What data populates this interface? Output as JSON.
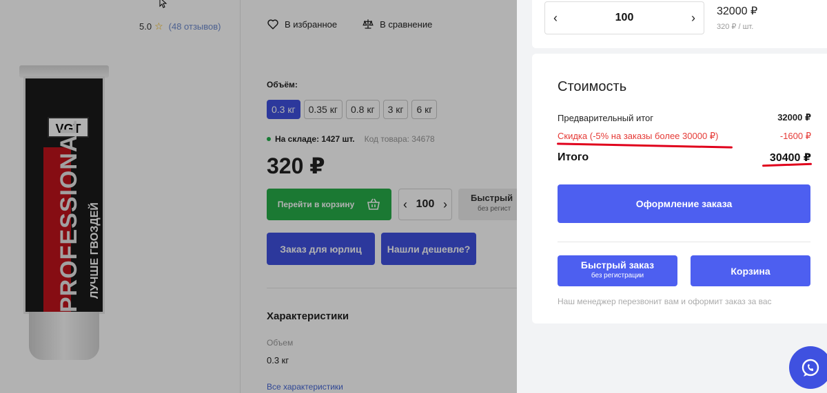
{
  "product": {
    "rating": "5.0",
    "reviews": "(48 отзывов)",
    "favorite_label": "В избранное",
    "compare_label": "В сравнение",
    "image": {
      "brand": "VGT",
      "line": "PROFESSIONAL",
      "slogan": "ЛУЧШЕ ГВОЗДЕЙ"
    },
    "volume_label": "Объём:",
    "volume_options": [
      "0.3 кг",
      "0.35 кг",
      "0.8 кг",
      "3 кг",
      "6 кг"
    ],
    "volume_selected": "0.3 кг",
    "stock_text": "На складе: 1427 шт.",
    "code_text": "Код товара: 34678",
    "price": "320 ₽",
    "go_to_cart_label": "Перейти в корзину",
    "quantity": "100",
    "quick_order_line1": "Быстрый",
    "quick_order_line2": "без регист",
    "legal_order_label": "Заказ для юрлиц",
    "found_cheaper_label": "Нашли дешевле?",
    "characteristics_title": "Характеристики",
    "char_key": "Объем",
    "char_value": "0.3 кг",
    "all_chars_link": "Все характеристики"
  },
  "cart": {
    "quantity": "100",
    "line_total": "32000 ₽",
    "unit_price": "320 ₽ / шт.",
    "cost_title": "Стоимость",
    "subtotal_label": "Предварительный итог",
    "subtotal_value": "32000 ₽",
    "discount_label": "Скидка (-5% на заказы более 30000 ₽)",
    "discount_value": "-1600 ₽",
    "total_label": "Итого",
    "total_value": "30400 ₽",
    "checkout_label": "Оформление заказа",
    "quick_order_label": "Быстрый заказ",
    "quick_order_sub": "без регистрации",
    "basket_label": "Корзина",
    "note": "Наш менеджер перезвонит вам и оформит заказ за вас"
  },
  "colors": {
    "accent": "#4d5ff0",
    "green": "#27ae4a",
    "discount_red": "#e53935",
    "annotation_red": "#e0001b"
  },
  "icons": [
    "heart-icon",
    "scales-icon",
    "star-icon",
    "basket-icon",
    "chat-icon",
    "chevron-left-icon",
    "chevron-right-icon",
    "cursor-icon"
  ]
}
